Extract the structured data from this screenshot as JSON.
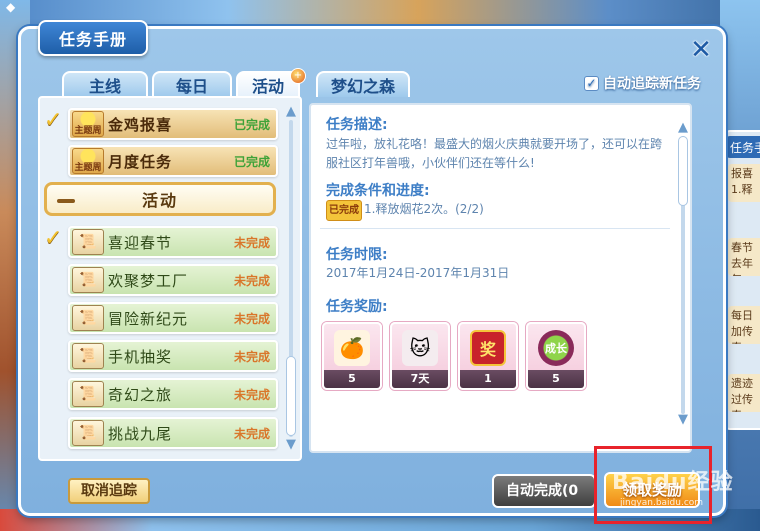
{
  "window": {
    "title": "任务手册",
    "close_label": "✕"
  },
  "tabs": [
    {
      "label": "主线"
    },
    {
      "label": "每日"
    },
    {
      "label": "活动"
    },
    {
      "label": "梦幻之森"
    }
  ],
  "active_tab": "活动",
  "tab_badge": "+",
  "auto_track": {
    "label": "自动追踪新任务",
    "checked": true,
    "check_glyph": "✓"
  },
  "tasks_main": [
    {
      "name": "金鸡报喜",
      "status": "已完成",
      "icon_label": "主题周",
      "tracked": true
    },
    {
      "name": "月度任务",
      "status": "已完成",
      "icon_label": "主题周",
      "tracked": false
    }
  ],
  "category": {
    "label": "活动"
  },
  "tasks_activity": [
    {
      "name": "喜迎春节",
      "status": "未完成",
      "tracked": true
    },
    {
      "name": "欢聚梦工厂",
      "status": "未完成",
      "tracked": false
    },
    {
      "name": "冒险新纪元",
      "status": "未完成",
      "tracked": false
    },
    {
      "name": "手机抽奖",
      "status": "未完成",
      "tracked": false
    },
    {
      "name": "奇幻之旅",
      "status": "未完成",
      "tracked": false
    },
    {
      "name": "挑战九尾",
      "status": "未完成",
      "tracked": false
    }
  ],
  "check_glyph": "✓",
  "detail": {
    "desc_heading": "任务描述:",
    "desc_line1": "过年啦，放礼花咯！最盛大的烟火庆典就要开场了，还可以在跨",
    "desc_line2": "服社区打年兽哦，小伙伴们还在等什么!",
    "cond_heading": "完成条件和进度:",
    "cond_badge": "已完成",
    "cond_text": "1.释放烟花2次。(2/2)",
    "time_heading": "任务时限:",
    "time_text": "2017年1月24日-2017年1月31日",
    "reward_heading": "任务奖励:",
    "rewards": [
      {
        "count": "5",
        "icon": "orange-fruit-icon",
        "glyph": "🍊",
        "color": "#f59a1e"
      },
      {
        "count": "7天",
        "icon": "cat-costume-icon",
        "glyph": "🐱",
        "color": "#5a4a4a"
      },
      {
        "count": "1",
        "icon": "lucky-card-icon",
        "glyph": "奖",
        "color": "#c8232b"
      },
      {
        "count": "5",
        "icon": "growth-apple-icon",
        "glyph": "成长",
        "color": "#8a2a5a"
      }
    ]
  },
  "buttons": {
    "cancel_track": "取消追踪",
    "auto_complete": "自动完成(0",
    "claim_reward": "领取奖励"
  },
  "watermark": {
    "main": "Baidu经验",
    "sub": "jingyan.baidu.com"
  },
  "peek_panel": {
    "tab": "任务手",
    "items": [
      "报喜\n1.释",
      "春节\n去年年",
      "每日\n加传奇",
      "遗迹\n过传奇"
    ]
  }
}
